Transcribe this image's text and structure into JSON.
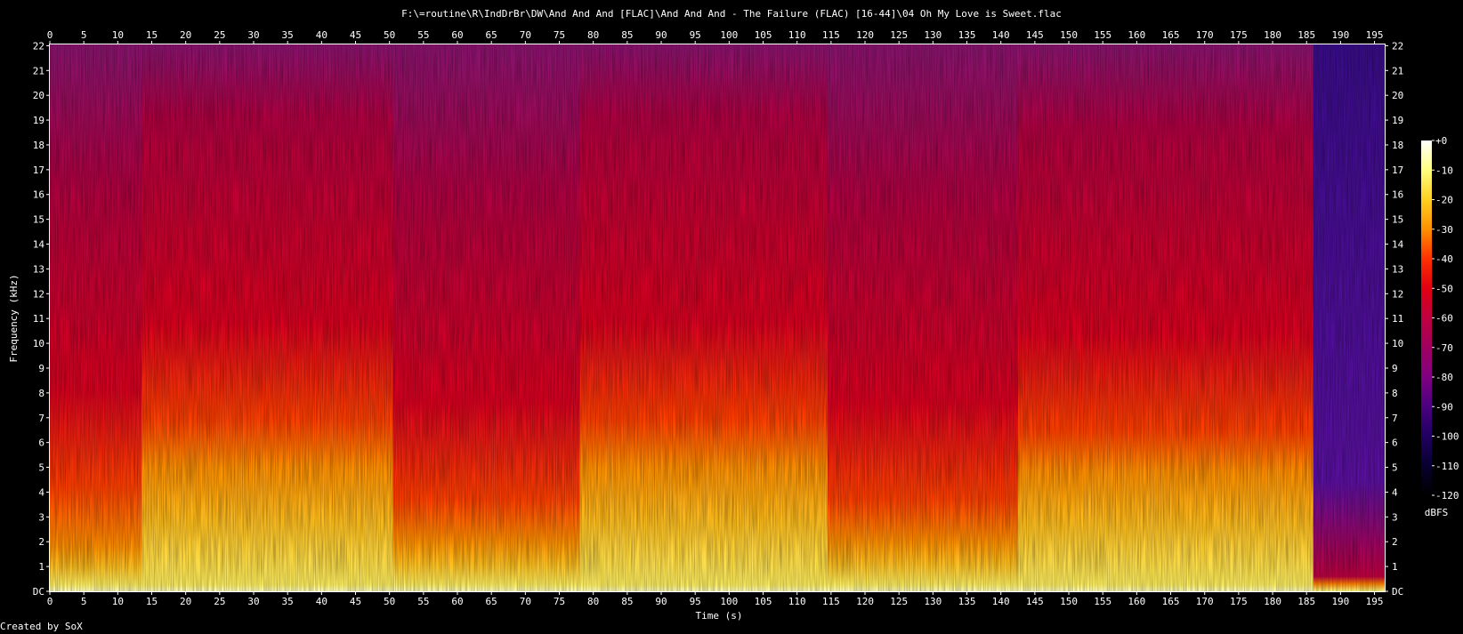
{
  "chart_data": {
    "type": "heatmap",
    "title": "F:\\=routine\\R\\IndDrBr\\DW\\And And And [FLAC]\\And And And - The Failure (FLAC) [16-44]\\04 Oh My Love is Sweet.flac",
    "xlabel": "Time (s)",
    "ylabel": "Frequency (kHz)",
    "xlim": [
      0,
      196.5
    ],
    "ylim": [
      0,
      22.05
    ],
    "x_ticks": [
      0,
      5,
      10,
      15,
      20,
      25,
      30,
      35,
      40,
      45,
      50,
      55,
      60,
      65,
      70,
      75,
      80,
      85,
      90,
      95,
      100,
      105,
      110,
      115,
      120,
      125,
      130,
      135,
      140,
      145,
      150,
      155,
      160,
      165,
      170,
      175,
      180,
      185,
      190,
      195
    ],
    "y_ticks": [
      "DC",
      "1",
      "2",
      "3",
      "4",
      "5",
      "6",
      "7",
      "8",
      "9",
      "10",
      "11",
      "12",
      "13",
      "14",
      "15",
      "16",
      "17",
      "18",
      "19",
      "20",
      "21",
      "22"
    ],
    "colorbar": {
      "label": "dBFS",
      "range": [
        -120,
        0
      ],
      "ticks": [
        "+0",
        "-10",
        "-20",
        "-30",
        "-40",
        "-50",
        "-60",
        "-70",
        "-80",
        "-90",
        "-100",
        "-110",
        "-120"
      ],
      "colors": [
        "#ffffff",
        "#ffff80",
        "#ffd020",
        "#ff9000",
        "#ff3000",
        "#e00010",
        "#c00040",
        "#a00060",
        "#800080",
        "#4a0080",
        "#200060",
        "#080030",
        "#000000"
      ]
    },
    "sections": [
      {
        "start": 0,
        "end": 13.5,
        "loud_top_khz": 4.2,
        "bright_top_khz": 1.8
      },
      {
        "start": 13.5,
        "end": 50.5,
        "loud_top_khz": 6.9,
        "bright_top_khz": 5.0
      },
      {
        "start": 50.5,
        "end": 78,
        "loud_top_khz": 3.7,
        "bright_top_khz": 2.0
      },
      {
        "start": 78,
        "end": 114.5,
        "loud_top_khz": 6.9,
        "bright_top_khz": 5.0
      },
      {
        "start": 114.5,
        "end": 142.5,
        "loud_top_khz": 3.7,
        "bright_top_khz": 2.0
      },
      {
        "start": 142.5,
        "end": 186,
        "loud_top_khz": 6.5,
        "bright_top_khz": 4.8
      },
      {
        "start": 186,
        "end": 196.5,
        "loud_top_khz": 0.6,
        "bright_top_khz": 0.3
      }
    ],
    "credit": "Created by SoX"
  }
}
